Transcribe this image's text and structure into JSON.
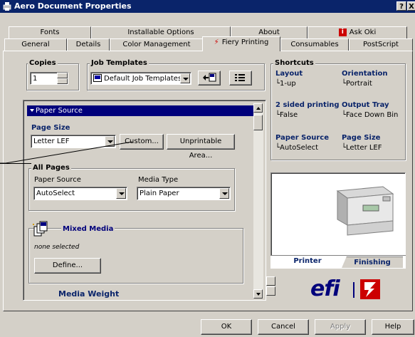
{
  "window": {
    "title": "Aero Document Properties",
    "help_btn": "?",
    "close_btn": "X"
  },
  "tabs_back": [
    "Fonts",
    "Installable Options",
    "About",
    "Ask Oki"
  ],
  "tabs_front": [
    "General",
    "Details",
    "Color Management",
    "Fiery Printing",
    "Consumables",
    "PostScript"
  ],
  "copies": {
    "label": "Copies",
    "value": "1"
  },
  "job_templates": {
    "label": "Job Templates",
    "value": "Default Job Templates"
  },
  "paper_source_header": "Paper Source",
  "page_size": {
    "label": "Page Size",
    "value": "Letter LEF",
    "custom_btn": "Custom...",
    "unprintable_btn": "Unprintable Area..."
  },
  "all_pages": {
    "label": "All Pages",
    "paper_source_label": "Paper Source",
    "paper_source_value": "AutoSelect",
    "media_type_label": "Media Type",
    "media_type_value": "Plain Paper"
  },
  "mixed_media": {
    "label": "Mixed Media",
    "status": "none selected",
    "define_btn": "Define..."
  },
  "media_weight_label": "Media Weight",
  "shortcuts": {
    "label": "Shortcuts",
    "layout_label": "Layout",
    "layout_value": "1-up",
    "orientation_label": "Orientation",
    "orientation_value": "Portrait",
    "two_sided_label": "2 sided printing",
    "two_sided_value": "False",
    "output_tray_label": "Output Tray",
    "output_tray_value": "Face Down Bin",
    "paper_source_label": "Paper Source",
    "paper_source_value": "AutoSelect",
    "page_size_label": "Page Size",
    "page_size_value": "Letter LEF"
  },
  "preview_tabs": {
    "printer": "Printer",
    "finishing": "Finishing"
  },
  "logo_text": "efi",
  "bottom_buttons": {
    "ok": "OK",
    "cancel": "Cancel",
    "apply": "Apply",
    "help": "Help"
  },
  "colors": {
    "titlebar": "#0a246a",
    "dialog_bg": "#d4d0c8",
    "accent_red": "#cc0000",
    "header_blue": "#00007b"
  }
}
